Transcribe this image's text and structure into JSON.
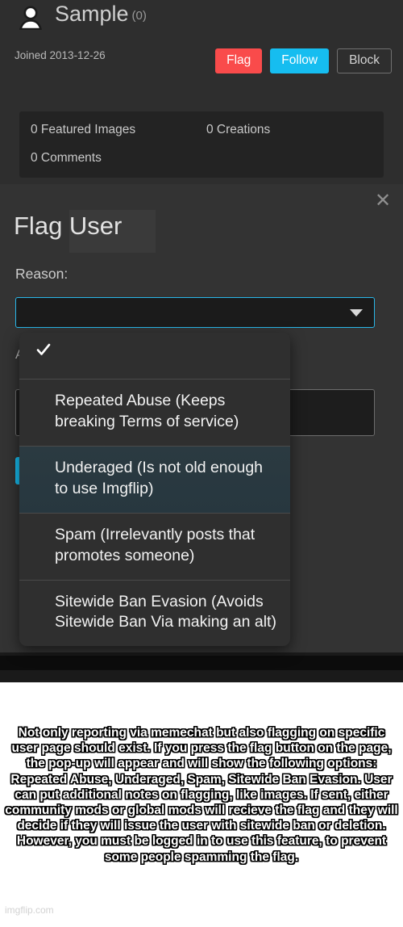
{
  "profile": {
    "avatar_icon": "user-avatar-icon",
    "username": "Sample",
    "post_count": "(0)",
    "joined": "Joined 2013-12-26",
    "actions": {
      "flag": "Flag",
      "follow": "Follow",
      "block": "Block"
    },
    "colors": {
      "flag_bg": "#f94b4b",
      "follow_bg": "#16bdf0",
      "page_bg": "#2e2e2e"
    },
    "stats": {
      "featured_images": "0 Featured Images",
      "creations": "0 Creations",
      "comments": "0 Comments"
    }
  },
  "background": {
    "featured_label": "Fea",
    "additional_label": "A"
  },
  "modal": {
    "close_icon": "close-icon",
    "title": "Flag User",
    "reason_label": "Reason:",
    "reason_value": "",
    "reason_placeholder": "",
    "caret_icon": "chevron-down-icon",
    "notes_label": "A",
    "notes_value": "",
    "submit_label": "",
    "accent_color": "#29b6e8"
  },
  "dropdown": {
    "check_icon": "checkmark-icon",
    "options": [
      {
        "label": "",
        "selected": true,
        "highlighted": false
      },
      {
        "label": "Repeated Abuse (Keeps breaking Terms of service)",
        "selected": false,
        "highlighted": false
      },
      {
        "label": "Underaged (Is not old enough to use Imgflip)",
        "selected": false,
        "highlighted": true
      },
      {
        "label": "Spam (Irrelevantly posts that promotes someone)",
        "selected": false,
        "highlighted": false
      },
      {
        "label": "Sitewide Ban Evasion (Avoids Sitewide Ban Via making an alt)",
        "selected": false,
        "highlighted": false
      }
    ]
  },
  "caption": {
    "text": "Not only reporting via memechat but also flagging on specific user page should exist. If you press the flag button on the page, the pop-up will appear and will show the following options: Repeated Abuse, Underaged, Spam, Sitewide Ban Evasion. User can put additional notes on flagging, like images. If sent, either community mods or global mods will recieve the flag and they will decide if they will issue the user with sitewide ban or deletion. However, you must be logged in to use this feature, to prevent some people spamming the flag.",
    "watermark": "imgflip.com"
  }
}
